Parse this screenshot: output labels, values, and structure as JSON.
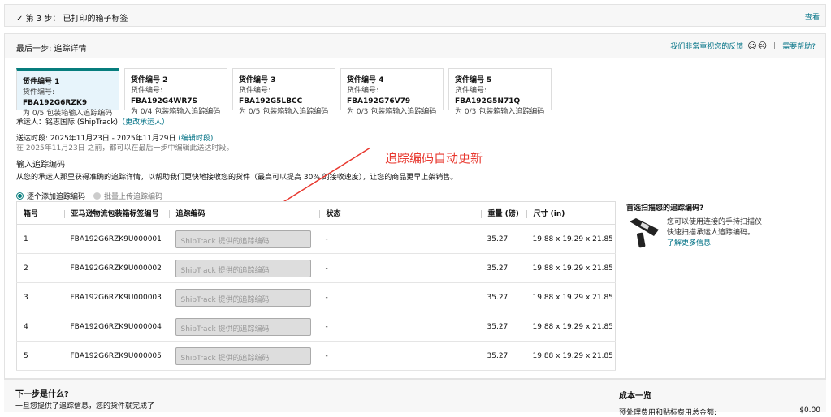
{
  "step3": {
    "check": "✓",
    "title": "第 3 步： 已打印的箱子标签",
    "view": "查看"
  },
  "final": {
    "title": "最后一步: 追踪详情",
    "feedback": "我们非常重视您的反馈",
    "separator": "|",
    "help": "需要帮助?"
  },
  "tabs": [
    {
      "title": "货件编号 1",
      "id_label": "货件编号: ",
      "id": "FBA192G6RZK9",
      "progress": "为 0/5 包装箱输入追踪编码"
    },
    {
      "title": "货件编号 2",
      "id_label": "货件编号: ",
      "id": "FBA192G4WR7S",
      "progress": "为 0/4 包装箱输入追踪编码"
    },
    {
      "title": "货件编号 3",
      "id_label": "货件编号: ",
      "id": "FBA192G5LBCC",
      "progress": "为 0/5 包装箱输入追踪编码"
    },
    {
      "title": "货件编号 4",
      "id_label": "货件编号: ",
      "id": "FBA192G76V79",
      "progress": "为 0/3 包装箱输入追踪编码"
    },
    {
      "title": "货件编号 5",
      "id_label": "货件编号: ",
      "id": "FBA192G5N71Q",
      "progress": "为 0/3 包装箱输入追踪编码"
    }
  ],
  "carrier": {
    "label": "承运人：铭志国际 (ShipTrack)",
    "change": "（更改承运人）"
  },
  "delivery": {
    "label": "送达时段: 2025年11月23日 - 2025年11月29日",
    "edit": "(编辑时段)",
    "note": "在 2025年11月23日 之前，都可以在最后一步中编辑此送达时段。"
  },
  "tracking": {
    "heading": "输入追踪编码",
    "desc": "从您的承运人那里获得准确的追踪详情，以帮助我们更快地接收您的货件（最高可以提高 30% 的接收速度），让您的商品更早上架销售。",
    "radio_one": "逐个添加追踪编码",
    "radio_bulk": "批量上传追踪编码"
  },
  "annotation": "追踪编码自动更新",
  "table": {
    "headers": [
      "箱号",
      "亚马逊物流包装箱标签编号",
      "追踪编码",
      "状态",
      "重量 (磅)",
      "尺寸 (in)"
    ],
    "placeholder": "ShipTrack 提供的追踪编码",
    "rows": [
      {
        "no": "1",
        "label": "FBA192G6RZK9U000001",
        "status": "-",
        "weight": "35.27",
        "dims": "19.88 x 19.29 x 21.85"
      },
      {
        "no": "2",
        "label": "FBA192G6RZK9U000002",
        "status": "-",
        "weight": "35.27",
        "dims": "19.88 x 19.29 x 21.85"
      },
      {
        "no": "3",
        "label": "FBA192G6RZK9U000003",
        "status": "-",
        "weight": "35.27",
        "dims": "19.88 x 19.29 x 21.85"
      },
      {
        "no": "4",
        "label": "FBA192G6RZK9U000004",
        "status": "-",
        "weight": "35.27",
        "dims": "19.88 x 19.29 x 21.85"
      },
      {
        "no": "5",
        "label": "FBA192G6RZK9U000005",
        "status": "-",
        "weight": "35.27",
        "dims": "19.88 x 19.29 x 21.85"
      }
    ]
  },
  "scan": {
    "title": "首选扫描您的追踪编码?",
    "line1": "您可以使用连接的手持扫描仪",
    "line2": "快速扫描承运人追踪编码。",
    "learn": "了解更多信息"
  },
  "footer": {
    "next_title": "下一步是什么?",
    "next_desc": "一旦您提供了追踪信息，您的货件就完成了",
    "cost_title": "成本一览",
    "cost_label": "预处理费用和贴标费用总金额:",
    "cost_value": "$0.00"
  }
}
